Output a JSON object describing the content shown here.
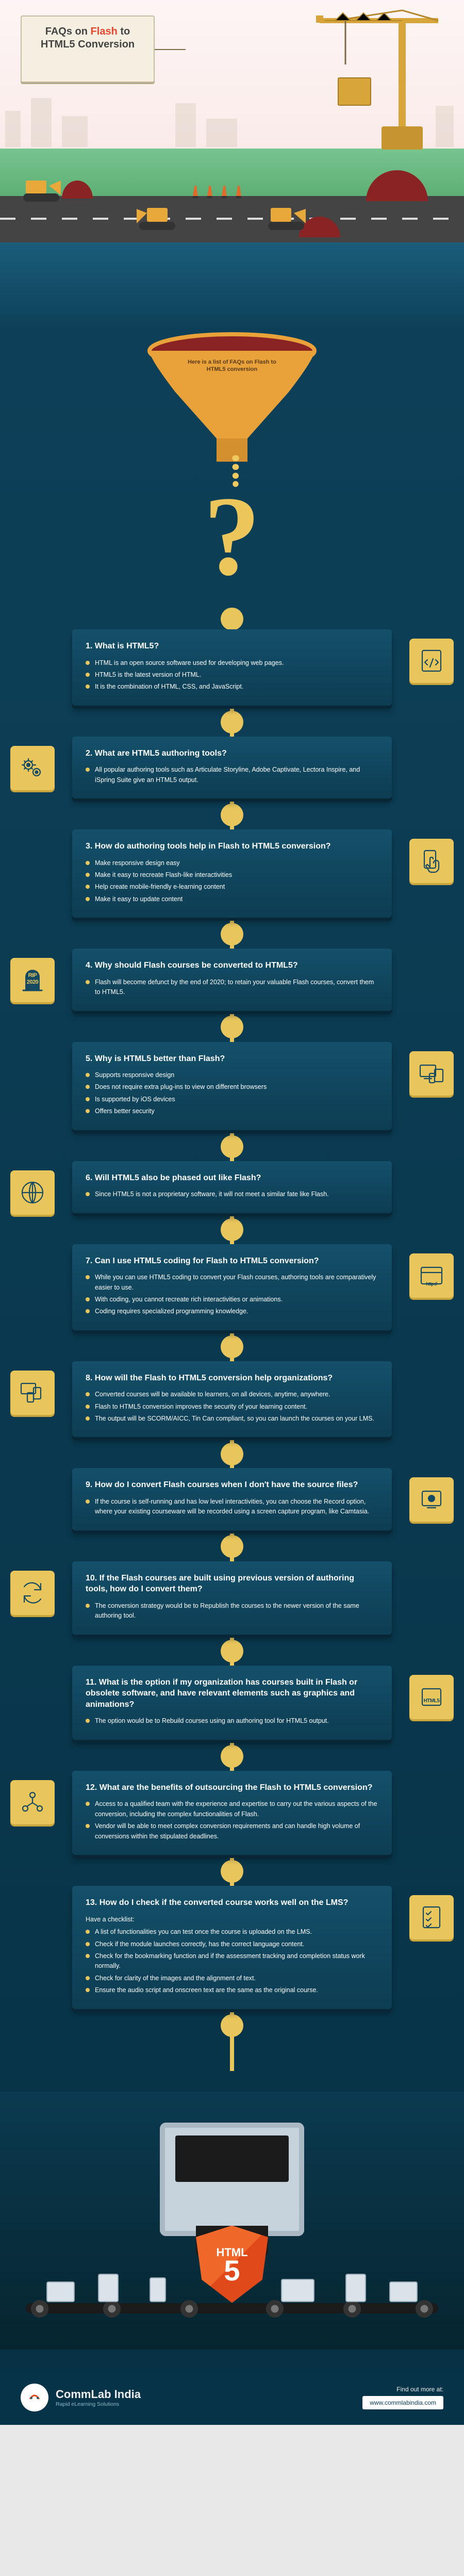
{
  "header": {
    "line1_pre": "FAQs on ",
    "line1_flash": "Flash",
    "line1_post": " to",
    "line2_html5": "HTML5",
    "line2_post": " Conversion"
  },
  "funnel": {
    "caption": "Here is a list of FAQs on Flash to HTML5 conversion"
  },
  "faqs": [
    {
      "q": "1. What is HTML5?",
      "icon": "code-page-icon",
      "side": "right",
      "bullets": [
        "HTML is an open source software used for developing web pages.",
        "HTML5 is the latest version of HTML.",
        "It is the combination of HTML, CSS, and JavaScript."
      ]
    },
    {
      "q": "2. What are HTML5 authoring tools?",
      "icon": "gears-icon",
      "side": "left",
      "bullets": [
        "All popular authoring tools such as Articulate Storyline, Adobe Captivate, Lectora Inspire, and iSpring Suite give an HTML5 output."
      ]
    },
    {
      "q": "3. How do authoring tools help in Flash to HTML5 conversion?",
      "icon": "touch-icon",
      "side": "right",
      "bullets": [
        "Make responsive design easy",
        "Make it easy to recreate Flash-like interactivities",
        "Help create mobile-friendly e-learning content",
        "Make it easy to update content"
      ]
    },
    {
      "q": "4. Why should Flash courses be converted to HTML5?",
      "icon": "tombstone-icon",
      "icon_text": "RIP 2020",
      "side": "left",
      "bullets": [
        "Flash will become defunct by the end of 2020; to retain your valuable Flash courses, convert them to HTML5."
      ]
    },
    {
      "q": "5. Why is HTML5 better than Flash?",
      "icon": "devices-icon",
      "side": "right",
      "bullets": [
        "Supports responsive design",
        "Does not require extra plug-ins to view on different browsers",
        "Is supported by iOS devices",
        "Offers better security"
      ]
    },
    {
      "q": "6. Will HTML5 also be phased out like Flash?",
      "icon": "globe-icon",
      "side": "left",
      "bullets": [
        "Since HTML5 is not a proprietary software, it will not meet a similar fate like Flash."
      ]
    },
    {
      "q": "7. Can I use HTML5 coding for Flash to HTML5 conversion?",
      "icon": "browser-icon",
      "icon_text": "http://",
      "side": "right",
      "bullets": [
        "While you can use HTML5 coding to convert your Flash courses, authoring tools are comparatively easier to use.",
        "With coding, you cannot recreate rich interactivities or animations.",
        "Coding requires specialized programming knowledge."
      ]
    },
    {
      "q": "8. How will the Flash to HTML5 conversion help organizations?",
      "icon": "multi-device-icon",
      "side": "left",
      "bullets": [
        "Converted courses will be available to learners, on all devices, anytime, anywhere.",
        "Flash to HTML5 conversion improves the security of your learning content.",
        "The output will be SCORM/AICC, Tin Can compliant, so you can launch the courses on your LMS."
      ]
    },
    {
      "q": "9. How do I convert Flash courses when I don't have the source files?",
      "icon": "record-icon",
      "side": "right",
      "bullets": [
        "If the course is self-running and has low level interactivities, you can choose the Record option, where your existing courseware will be recorded using a screen capture program, like Camtasia."
      ]
    },
    {
      "q": "10. If the Flash courses are built using previous version of authoring tools, how do I convert them?",
      "icon": "cycle-icon",
      "side": "left",
      "bullets": [
        "The conversion strategy would be to Republish the courses to the newer version of the same authoring tool."
      ]
    },
    {
      "q": "11. What is the option if my organization has courses built in Flash or obsolete software, and have relevant elements such as graphics and animations?",
      "icon": "html5-box-icon",
      "icon_text": "HTML5",
      "side": "right",
      "bullets": [
        "The option would be to Rebuild courses using an authoring tool for HTML5 output."
      ]
    },
    {
      "q": "12. What are the benefits of outsourcing the Flash to HTML5 conversion?",
      "icon": "network-icon",
      "side": "left",
      "bullets": [
        "Access to a qualified team with the experience and expertise to carry out the various aspects of the conversion, including the complex functionalities of Flash.",
        "Vendor will be able to meet complex conversion requirements and can handle high volume of conversions within the stipulated deadlines."
      ]
    },
    {
      "q": "13. How do I check if the converted course works well on the LMS?",
      "subtitle": "Have a checklist:",
      "icon": "checklist-icon",
      "side": "right",
      "bullets": [
        "A list of functionalities you can test once the course is uploaded on the LMS.",
        "Check if the module launches correctly, has the correct language content.",
        "Check for the bookmarking function and if the assessment tracking and completion status work normally.",
        "Check for clarity of the images and the alignment of text.",
        "Ensure the audio script and onscreen text are the same as the original course."
      ]
    }
  ],
  "shield": {
    "top": "HTML",
    "num": "5"
  },
  "footer": {
    "find_label": "Find out more at:",
    "url": "www.commlabindia.com",
    "brand": "CommLab India",
    "tagline": "Rapid eLearning Solutions"
  }
}
